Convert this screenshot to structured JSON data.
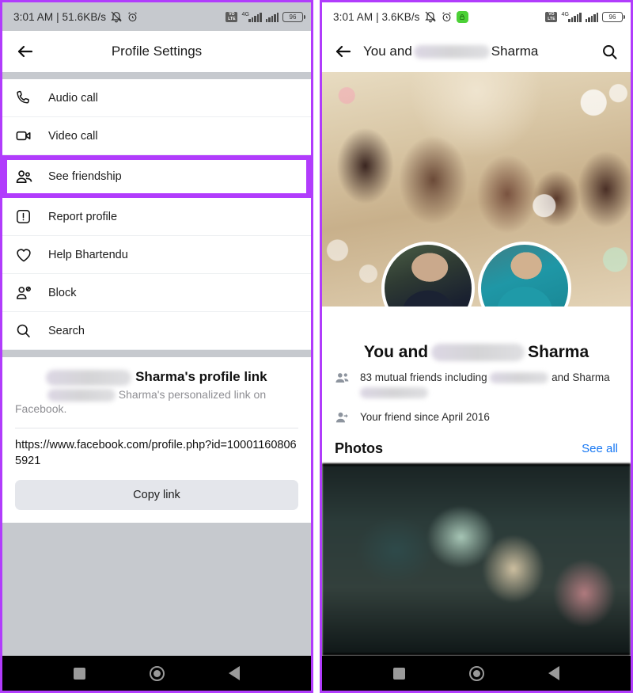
{
  "left_panel": {
    "status_bar": {
      "time_and_speed": "3:01 AM | 51.6KB/s",
      "mute_icon": "bell-muted-icon",
      "alarm_icon": "alarm-clock-icon",
      "volte_line1": "VO",
      "volte_line2": "LTE",
      "network_label": "4G",
      "battery_level": "96"
    },
    "header": {
      "back_icon": "back-arrow-icon",
      "title": "Profile Settings"
    },
    "menu_items": [
      {
        "label": "Audio call",
        "icon": "phone-icon",
        "highlighted": false
      },
      {
        "label": "Video call",
        "icon": "video-camera-icon",
        "highlighted": false
      },
      {
        "label": "See friendship",
        "icon": "two-people-icon",
        "highlighted": true
      },
      {
        "label": "Report profile",
        "icon": "exclamation-box-icon",
        "highlighted": false
      },
      {
        "label": "Help Bhartendu",
        "icon": "heart-icon",
        "highlighted": false
      },
      {
        "label": "Block",
        "icon": "person-blocked-icon",
        "highlighted": false
      },
      {
        "label": "Search",
        "icon": "search-icon",
        "highlighted": false
      }
    ],
    "profile_link_card": {
      "title_redacted": true,
      "title": "Sharma's profile link",
      "subtitle_part1": "Sharma's personalized link on",
      "subtitle_part2": "Facebook.",
      "url": "https://www.facebook.com/profile.php?id=100011608065921",
      "copy_button": "Copy link"
    },
    "nav_bar": {
      "recents_icon": "square-recents-icon",
      "home_icon": "circle-home-icon",
      "back_icon": "triangle-back-icon"
    }
  },
  "right_panel": {
    "status_bar": {
      "time_and_speed": "3:01 AM | 3.6KB/s",
      "mute_icon": "bell-muted-icon",
      "alarm_icon": "alarm-clock-icon",
      "shield_icon": "green-lock-badge-icon",
      "volte_line1": "VO",
      "volte_line2": "LTE",
      "network_label": "4G",
      "battery_level": "96"
    },
    "header": {
      "back_icon": "back-arrow-icon",
      "title_prefix": "You and",
      "title_suffix": "Sharma",
      "search_icon": "search-icon"
    },
    "cover": {
      "image_alt": "family-group-cover-photo",
      "avatar_1_alt": "user-profile-photo",
      "avatar_2_alt": "friend-profile-photo"
    },
    "friendship": {
      "heading_prefix": "You and",
      "heading_suffix": "Sharma",
      "mutual_friends_icon": "two-people-icon",
      "mutual_friends_prefix": "83 mutual friends including",
      "mutual_friends_suffix": "and Sharma",
      "friend_since_icon": "add-friend-icon",
      "friend_since": "Your friend since April 2016"
    },
    "photos": {
      "title": "Photos",
      "see_all": "See all",
      "strip_alt": "blurred-photo-thumbnail"
    },
    "nav_bar": {
      "recents_icon": "square-recents-icon",
      "home_icon": "circle-home-icon",
      "back_icon": "triangle-back-icon"
    }
  },
  "colors": {
    "accent_purple": "#b13cfc",
    "link_blue": "#1878f3",
    "status_gray": "#c6c9ce",
    "button_gray": "#e4e6eb"
  }
}
